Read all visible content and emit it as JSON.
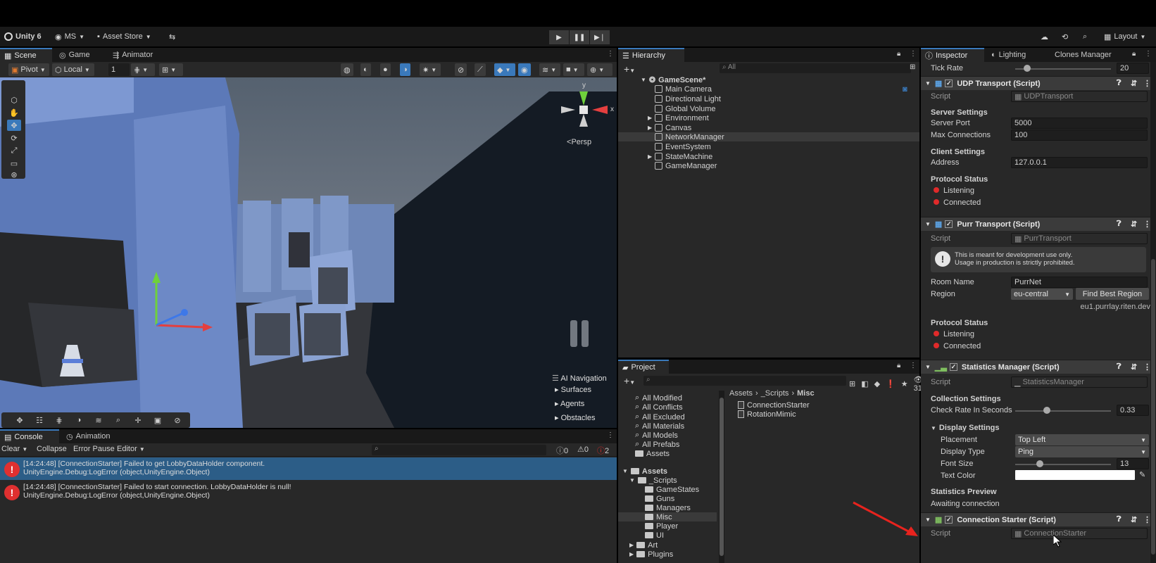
{
  "toolbar": {
    "app_title": "Unity 6",
    "account": "MS",
    "asset_store": "Asset Store",
    "layout": "Layout"
  },
  "scene_panel": {
    "tabs": [
      "Scene",
      "Game",
      "Animator"
    ],
    "pivot": "Pivot",
    "local": "Local",
    "grid_snap": "1",
    "persp": "Persp",
    "gizmo_axes": {
      "y": "y",
      "x": "x"
    },
    "ai_nav": {
      "title": "AI Navigation",
      "items": [
        "Surfaces",
        "Agents",
        "Obstacles"
      ]
    }
  },
  "console": {
    "tabs": [
      "Console",
      "Animation"
    ],
    "clear": "Clear",
    "collapse": "Collapse",
    "error_pause": "Error Pause",
    "editor": "Editor",
    "counts": {
      "info": "0",
      "warn": "0",
      "error": "2"
    },
    "logs": [
      {
        "line1": "[14:24:48] [ConnectionStarter] Failed to get LobbyDataHolder component.",
        "line2": "UnityEngine.Debug:LogError (object,UnityEngine.Object)"
      },
      {
        "line1": "[14:24:48] [ConnectionStarter] Failed to start connection. LobbyDataHolder is null!",
        "line2": "UnityEngine.Debug:LogError (object,UnityEngine.Object)"
      }
    ]
  },
  "hierarchy": {
    "title": "Hierarchy",
    "search_placeholder": "All",
    "scene": "GameScene*",
    "items": [
      "Main Camera",
      "Directional Light",
      "Global Volume",
      "Environment",
      "Canvas",
      "NetworkManager",
      "EventSystem",
      "StateMachine",
      "GameManager"
    ]
  },
  "project": {
    "title": "Project",
    "count": "31",
    "favorites": [
      "All Modified",
      "All Conflicts",
      "All Excluded",
      "All Materials",
      "All Models",
      "All Prefabs",
      "Assets"
    ],
    "assets_root": "Assets",
    "tree": [
      "_Scripts",
      "GameStates",
      "Guns",
      "Managers",
      "Misc",
      "Player",
      "UI",
      "Art",
      "Plugins"
    ],
    "breadcrumb": [
      "Assets",
      "_Scripts",
      "Misc"
    ],
    "files": [
      "ConnectionStarter",
      "RotationMimic"
    ]
  },
  "inspector": {
    "tabs": [
      "Inspector",
      "Lighting",
      "Clones Manager"
    ],
    "tick_rate_label": "Tick Rate",
    "tick_rate": "20",
    "udp": {
      "title": "UDP Transport (Script)",
      "script_label": "Script",
      "script_value": "UDPTransport",
      "server_settings": "Server Settings",
      "server_port_label": "Server Port",
      "server_port": "5000",
      "max_conn_label": "Max Connections",
      "max_conn": "100",
      "client_settings": "Client Settings",
      "address_label": "Address",
      "address": "127.0.0.1",
      "protocol_status": "Protocol Status",
      "listening": "Listening",
      "connected": "Connected"
    },
    "purr": {
      "title": "Purr Transport (Script)",
      "script_label": "Script",
      "script_value": "PurrTransport",
      "help_line1": "This is meant for development use only.",
      "help_line2": "Usage in production is strictly prohibited.",
      "room_name_label": "Room Name",
      "room_name": "PurrNet",
      "region_label": "Region",
      "region": "eu-central",
      "find_best": "Find Best Region",
      "host": "eu1.purrlay.riten.dev",
      "protocol_status": "Protocol Status",
      "listening": "Listening",
      "connected": "Connected"
    },
    "stats": {
      "title": "Statistics Manager (Script)",
      "script_label": "Script",
      "script_value": "StatisticsManager",
      "collection_settings": "Collection Settings",
      "check_rate_label": "Check Rate In Seconds",
      "check_rate": "0.33",
      "display_settings": "Display Settings",
      "placement_label": "Placement",
      "placement": "Top Left",
      "display_type_label": "Display Type",
      "display_type": "Ping",
      "font_size_label": "Font Size",
      "font_size": "13",
      "text_color_label": "Text Color",
      "preview_title": "Statistics Preview",
      "preview_text": "Awaiting connection"
    },
    "conn": {
      "title": "Connection Starter (Script)",
      "script_label": "Script",
      "script_value": "ConnectionStarter"
    }
  },
  "colors": {
    "accent": "#3a79bb",
    "error": "#e02a2a",
    "arrow": "#e8231e"
  }
}
